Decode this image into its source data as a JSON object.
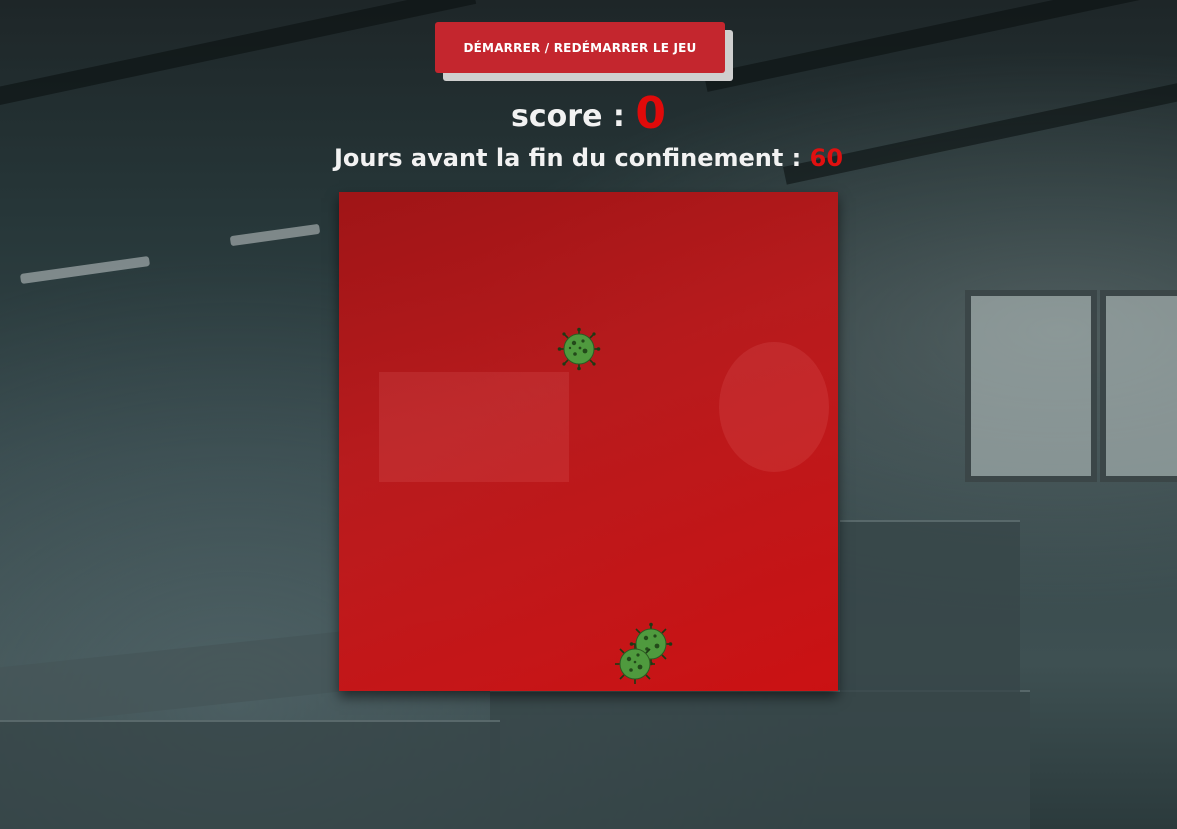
{
  "game": {
    "start_button_label": "DÉMARRER / REDÉMARRER LE JEU",
    "score_label": "score : ",
    "score_value": "0",
    "days_label": "Jours avant la fin du confinement : ",
    "days_value": "60"
  },
  "colors": {
    "accent_red": "#c4262e",
    "score_red": "#e00a0a",
    "board_red": "#d41214",
    "virus_green": "#4f9a3e"
  },
  "icons": {
    "virus": "coronavirus-icon"
  }
}
